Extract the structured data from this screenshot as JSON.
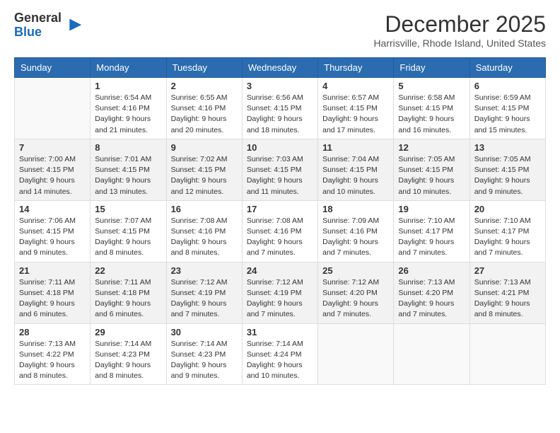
{
  "logo": {
    "general": "General",
    "blue": "Blue"
  },
  "header": {
    "month": "December 2025",
    "location": "Harrisville, Rhode Island, United States"
  },
  "weekdays": [
    "Sunday",
    "Monday",
    "Tuesday",
    "Wednesday",
    "Thursday",
    "Friday",
    "Saturday"
  ],
  "weeks": [
    [
      {
        "day": "",
        "empty": true
      },
      {
        "day": "1",
        "sunrise": "6:54 AM",
        "sunset": "4:16 PM",
        "daylight": "9 hours and 21 minutes."
      },
      {
        "day": "2",
        "sunrise": "6:55 AM",
        "sunset": "4:16 PM",
        "daylight": "9 hours and 20 minutes."
      },
      {
        "day": "3",
        "sunrise": "6:56 AM",
        "sunset": "4:15 PM",
        "daylight": "9 hours and 18 minutes."
      },
      {
        "day": "4",
        "sunrise": "6:57 AM",
        "sunset": "4:15 PM",
        "daylight": "9 hours and 17 minutes."
      },
      {
        "day": "5",
        "sunrise": "6:58 AM",
        "sunset": "4:15 PM",
        "daylight": "9 hours and 16 minutes."
      },
      {
        "day": "6",
        "sunrise": "6:59 AM",
        "sunset": "4:15 PM",
        "daylight": "9 hours and 15 minutes."
      }
    ],
    [
      {
        "day": "7",
        "sunrise": "7:00 AM",
        "sunset": "4:15 PM",
        "daylight": "9 hours and 14 minutes."
      },
      {
        "day": "8",
        "sunrise": "7:01 AM",
        "sunset": "4:15 PM",
        "daylight": "9 hours and 13 minutes."
      },
      {
        "day": "9",
        "sunrise": "7:02 AM",
        "sunset": "4:15 PM",
        "daylight": "9 hours and 12 minutes."
      },
      {
        "day": "10",
        "sunrise": "7:03 AM",
        "sunset": "4:15 PM",
        "daylight": "9 hours and 11 minutes."
      },
      {
        "day": "11",
        "sunrise": "7:04 AM",
        "sunset": "4:15 PM",
        "daylight": "9 hours and 10 minutes."
      },
      {
        "day": "12",
        "sunrise": "7:05 AM",
        "sunset": "4:15 PM",
        "daylight": "9 hours and 10 minutes."
      },
      {
        "day": "13",
        "sunrise": "7:05 AM",
        "sunset": "4:15 PM",
        "daylight": "9 hours and 9 minutes."
      }
    ],
    [
      {
        "day": "14",
        "sunrise": "7:06 AM",
        "sunset": "4:15 PM",
        "daylight": "9 hours and 9 minutes."
      },
      {
        "day": "15",
        "sunrise": "7:07 AM",
        "sunset": "4:15 PM",
        "daylight": "9 hours and 8 minutes."
      },
      {
        "day": "16",
        "sunrise": "7:08 AM",
        "sunset": "4:16 PM",
        "daylight": "9 hours and 8 minutes."
      },
      {
        "day": "17",
        "sunrise": "7:08 AM",
        "sunset": "4:16 PM",
        "daylight": "9 hours and 7 minutes."
      },
      {
        "day": "18",
        "sunrise": "7:09 AM",
        "sunset": "4:16 PM",
        "daylight": "9 hours and 7 minutes."
      },
      {
        "day": "19",
        "sunrise": "7:10 AM",
        "sunset": "4:17 PM",
        "daylight": "9 hours and 7 minutes."
      },
      {
        "day": "20",
        "sunrise": "7:10 AM",
        "sunset": "4:17 PM",
        "daylight": "9 hours and 7 minutes."
      }
    ],
    [
      {
        "day": "21",
        "sunrise": "7:11 AM",
        "sunset": "4:18 PM",
        "daylight": "9 hours and 6 minutes."
      },
      {
        "day": "22",
        "sunrise": "7:11 AM",
        "sunset": "4:18 PM",
        "daylight": "9 hours and 6 minutes."
      },
      {
        "day": "23",
        "sunrise": "7:12 AM",
        "sunset": "4:19 PM",
        "daylight": "9 hours and 7 minutes."
      },
      {
        "day": "24",
        "sunrise": "7:12 AM",
        "sunset": "4:19 PM",
        "daylight": "9 hours and 7 minutes."
      },
      {
        "day": "25",
        "sunrise": "7:12 AM",
        "sunset": "4:20 PM",
        "daylight": "9 hours and 7 minutes."
      },
      {
        "day": "26",
        "sunrise": "7:13 AM",
        "sunset": "4:20 PM",
        "daylight": "9 hours and 7 minutes."
      },
      {
        "day": "27",
        "sunrise": "7:13 AM",
        "sunset": "4:21 PM",
        "daylight": "9 hours and 8 minutes."
      }
    ],
    [
      {
        "day": "28",
        "sunrise": "7:13 AM",
        "sunset": "4:22 PM",
        "daylight": "9 hours and 8 minutes."
      },
      {
        "day": "29",
        "sunrise": "7:14 AM",
        "sunset": "4:23 PM",
        "daylight": "9 hours and 8 minutes."
      },
      {
        "day": "30",
        "sunrise": "7:14 AM",
        "sunset": "4:23 PM",
        "daylight": "9 hours and 9 minutes."
      },
      {
        "day": "31",
        "sunrise": "7:14 AM",
        "sunset": "4:24 PM",
        "daylight": "9 hours and 10 minutes."
      },
      {
        "day": "",
        "empty": true
      },
      {
        "day": "",
        "empty": true
      },
      {
        "day": "",
        "empty": true
      }
    ]
  ],
  "labels": {
    "sunrise": "Sunrise:",
    "sunset": "Sunset:",
    "daylight": "Daylight:"
  }
}
